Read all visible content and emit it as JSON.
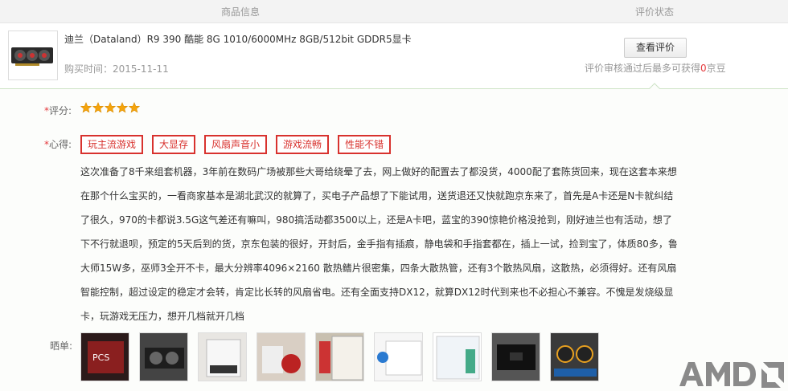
{
  "header": {
    "col_info": "商品信息",
    "col_status": "评价状态"
  },
  "product": {
    "title": "迪兰（Dataland）R9 390 酷能 8G 1010/6000MHz 8GB/512bit GDDR5显卡",
    "purchase_label": "购买时间：",
    "purchase_date": "2015-11-11",
    "view_button": "查看评价",
    "reward_prefix": "评价审核通过后最多可获得",
    "reward_num": "0",
    "reward_suffix": "京豆"
  },
  "review": {
    "score_label": "评分:",
    "score_required": "*",
    "rating": 5,
    "rating_max": 5,
    "comment_label": "心得:",
    "comment_required": "*",
    "tags": [
      "玩主流游戏",
      "大显存",
      "风扇声音小",
      "游戏流畅",
      "性能不错"
    ],
    "content": "这次准备了8千来组套机器，3年前在数码广场被那些大哥给绕晕了去，网上做好的配置去了都没货，4000配了套陈货回来，现在这套本来想在那个什么宝买的，一看商家基本是湖北武汉的就算了，买电子产品想了下能试用，送货退还又快就跑京东来了，首先是A卡还是N卡就纠结了很久，970的卡都说3.5G这气差还有嘛叫，980搞活动都3500以上，还是A卡吧，蓝宝的390惊艳价格没抢到，刚好迪兰也有活动，想了下不行就退呗，预定的5天后到的货，京东包装的很好，开封后，金手指有插痕，静电袋和手指套都在，插上一试，捡到宝了，体质80多，鲁大师15W多，巫师3全开不卡，最大分辨率4096×2160 散热鳍片很密集，四条大散热管，还有3个散热风扇，这散热，必须得好。还有风扇智能控制，超过设定的稳定才会转，肯定比长转的风扇省电。还有全面支持DX12，就算DX12时代到来也不必担心不兼容。不愧是发烧级显卡，玩游戏无压力，想开几档就开几档",
    "photos_label": "晒单:"
  },
  "colors": {
    "accent_red": "#d8322e",
    "star_gold": "#f5a40c",
    "divider_green": "#cde3c6"
  },
  "logo_icon": "amd-logo"
}
